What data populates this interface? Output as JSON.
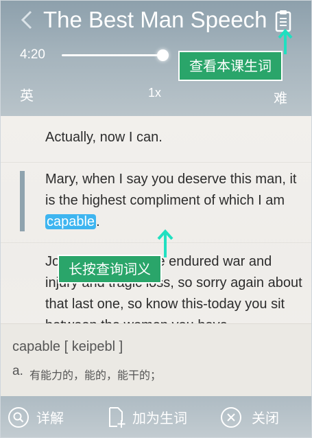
{
  "header": {
    "title": "The Best Man Speech",
    "back_icon": "chevron-left-icon",
    "vocab_icon": "clipboard-icon"
  },
  "player": {
    "time": "4:20",
    "progress": 0.95,
    "left_label": "英",
    "speed": "1x",
    "right_label": "难"
  },
  "transcript": {
    "line1": "Actually, now I can.",
    "line2_before": "Mary, when I say you deserve this man, it is the highest compliment of which I am ",
    "line2_highlight": "capable",
    "line2_after": ".",
    "line3": "Jonathan, you have endured war and injury and tragic loss, so sorry again about that last one, so know this-today you sit between the women you have"
  },
  "tooltips": {
    "vocab": "查看本课生词",
    "lookup": "长按查询词义"
  },
  "definition": {
    "word": "capable [ keipebl ]",
    "pos": "a.",
    "meaning": "有能力的，能的，能干的；"
  },
  "bottom_bar": {
    "detail": "详解",
    "add": "加为生词",
    "close": "关闭"
  },
  "colors": {
    "highlight": "#3eb5f0",
    "tooltip": "#2aa56a",
    "arrow": "#20e0c0",
    "header": "#8da0ac"
  }
}
